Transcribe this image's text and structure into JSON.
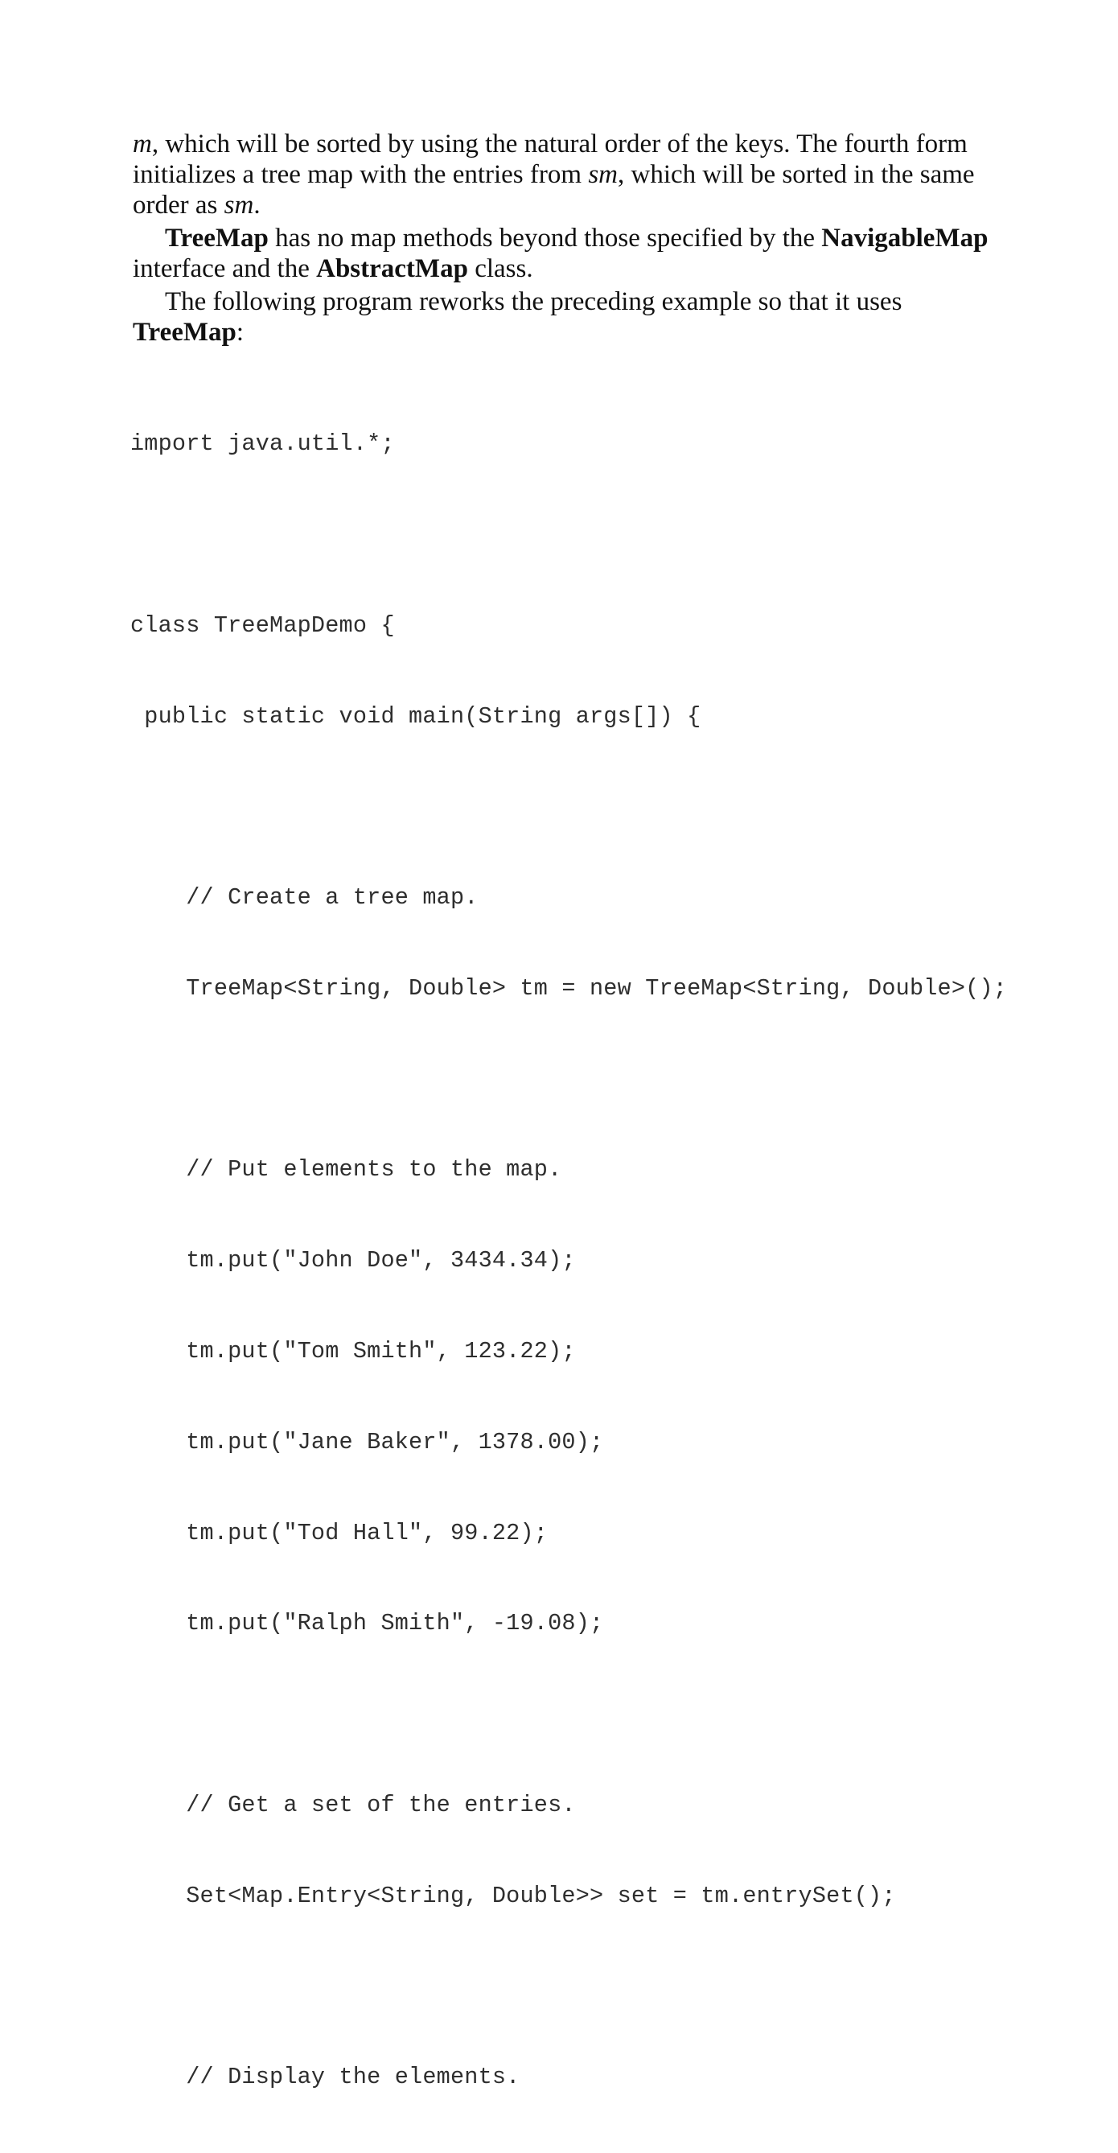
{
  "paragraph1": {
    "m": "m",
    "part1": ", which will be sorted by using the natural order of the keys. The fourth form initializes a tree map with the entries from ",
    "sm1": "sm",
    "part2": ", which will be sorted in the same order as ",
    "sm2": "sm",
    "part3": "."
  },
  "paragraph2": {
    "treemap": "TreeMap",
    "part1": " has no map methods beyond those specified by the ",
    "navigablemap": "NavigableMap",
    "part2": " interface and the ",
    "abstractmap": "AbstractMap",
    "part3": " class."
  },
  "paragraph3": {
    "part1": "The following program reworks the preceding example so that it uses ",
    "treemap": "TreeMap",
    "part2": ":"
  },
  "code": {
    "lines": [
      "import java.util.*;",
      "",
      "class TreeMapDemo {",
      " public static void main(String args[]) {",
      "",
      "    // Create a tree map.",
      "    TreeMap<String, Double> tm = new TreeMap<String, Double>();",
      "",
      "    // Put elements to the map.",
      "    tm.put(\"John Doe\", 3434.34);",
      "    tm.put(\"Tom Smith\", 123.22);",
      "    tm.put(\"Jane Baker\", 1378.00);",
      "    tm.put(\"Tod Hall\", 99.22);",
      "    tm.put(\"Ralph Smith\", -19.08);",
      "",
      "    // Get a set of the entries.",
      "    Set<Map.Entry<String, Double>> set = tm.entrySet();",
      "",
      "    // Display the elements."
    ]
  }
}
